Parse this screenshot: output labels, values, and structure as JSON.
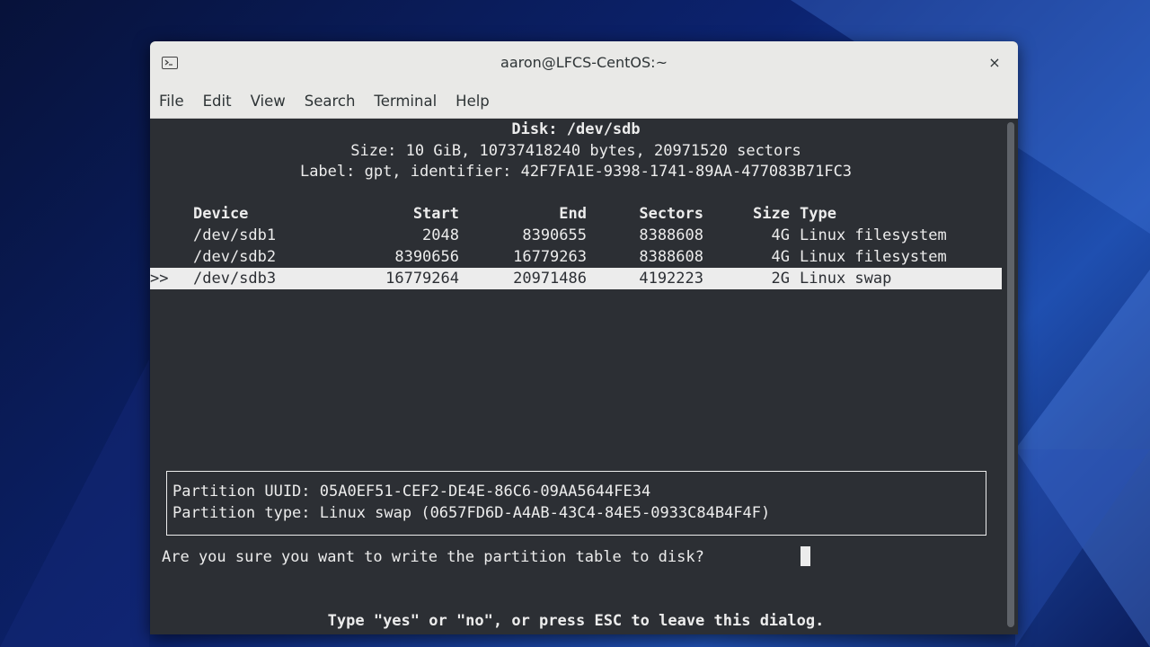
{
  "window": {
    "title": "aaron@LFCS-CentOS:~",
    "close_label": "×"
  },
  "menu": [
    "File",
    "Edit",
    "View",
    "Search",
    "Terminal",
    "Help"
  ],
  "disk": {
    "header": "Disk: /dev/sdb",
    "size": "Size: 10 GiB, 10737418240 bytes, 20971520 sectors",
    "label": "Label: gpt, identifier: 42F7FA1E-9398-1741-89AA-477083B71FC3"
  },
  "table": {
    "headers": {
      "device": "Device",
      "start": "Start",
      "end": "End",
      "sectors": "Sectors",
      "size": "Size",
      "type": "Type"
    },
    "rows": [
      {
        "marker": "",
        "device": "/dev/sdb1",
        "start": "2048",
        "end": "8390655",
        "sectors": "8388608",
        "size": "4G",
        "type": "Linux filesystem"
      },
      {
        "marker": "",
        "device": "/dev/sdb2",
        "start": "8390656",
        "end": "16779263",
        "sectors": "8388608",
        "size": "4G",
        "type": "Linux filesystem"
      },
      {
        "marker": ">>",
        "device": "/dev/sdb3",
        "start": "16779264",
        "end": "20971486",
        "sectors": "4192223",
        "size": "2G",
        "type": "Linux swap"
      }
    ]
  },
  "partition_info": {
    "uuid": "Partition UUID: 05A0EF51-CEF2-DE4E-86C6-09AA5644FE34",
    "type": "Partition type: Linux swap (0657FD6D-A4AB-43C4-84E5-0933C84B4F4F)"
  },
  "prompt": "Are you sure you want to write the partition table to disk?",
  "hint": "Type \"yes\" or \"no\", or press ESC to leave this dialog."
}
